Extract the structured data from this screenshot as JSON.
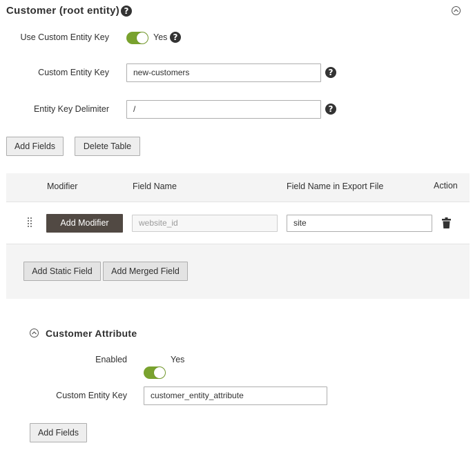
{
  "root": {
    "title": "Customer (root entity)",
    "help": "?",
    "use_custom_key": {
      "label": "Use Custom Entity Key",
      "state": "Yes",
      "help": "?"
    },
    "custom_key": {
      "label": "Custom Entity Key",
      "value": "new-customers",
      "help": "?"
    },
    "delimiter": {
      "label": "Entity Key Delimiter",
      "value": "/",
      "help": "?"
    },
    "buttons": {
      "add_fields": "Add Fields",
      "delete_table": "Delete Table"
    }
  },
  "table": {
    "headers": {
      "modifier": "Modifier",
      "field_name": "Field Name",
      "export_name": "Field Name in Export File",
      "action": "Action"
    },
    "row": {
      "modifier_button": "Add Modifier",
      "field_name_placeholder": "website_id",
      "export_name_value": "site"
    },
    "footer_buttons": {
      "add_static": "Add Static Field",
      "add_merged": "Add Merged Field"
    }
  },
  "attribute": {
    "title": "Customer Attribute",
    "enabled": {
      "label": "Enabled",
      "state": "Yes"
    },
    "custom_key": {
      "label": "Custom Entity Key",
      "value": "customer_entity_attribute"
    },
    "add_fields": "Add Fields"
  },
  "colors": {
    "toggle_on": "#79a22e",
    "dark_button": "#514943",
    "table_bg": "#f4f4f4"
  }
}
